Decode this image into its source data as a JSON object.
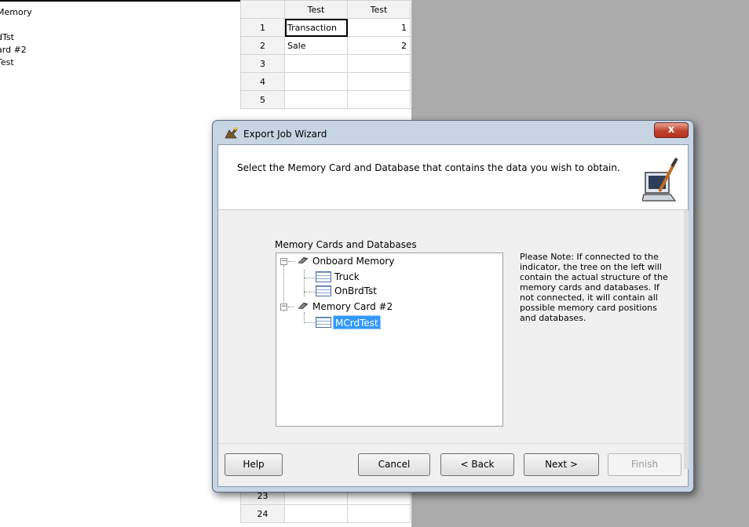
{
  "background": {
    "left_tree": [
      "Memory",
      "",
      "dTst",
      "ard #2",
      "Test"
    ],
    "grid": {
      "headers": [
        "",
        "Test",
        "Test"
      ],
      "rows": [
        {
          "num": "1",
          "c1": "Transaction",
          "c2": "1"
        },
        {
          "num": "2",
          "c1": "Sale",
          "c2": "2"
        },
        {
          "num": "3",
          "c1": "",
          "c2": ""
        },
        {
          "num": "4",
          "c1": "",
          "c2": ""
        },
        {
          "num": "5",
          "c1": "",
          "c2": ""
        }
      ],
      "bottom_rows": [
        "23",
        "24"
      ]
    }
  },
  "dialog": {
    "title": "Export Job Wizard",
    "close_label": "x",
    "instruction": "Select the Memory Card and Database that contains the data you wish to obtain.",
    "group_label": "Memory Cards and Databases",
    "tree": {
      "onboard": "Onboard Memory",
      "truck": "Truck",
      "onbrdtst": "OnBrdTst",
      "card2": "Memory Card #2",
      "mcrdtest": "MCrdTest"
    },
    "note": "Please Note: If connected to the indicator, the tree on the left will contain the actual structure of the memory cards and databases. If not connected, it will contain all possible memory card positions and databases.",
    "buttons": {
      "help": "Help",
      "cancel": "Cancel",
      "back": "< Back",
      "next": "Next >",
      "finish": "Finish"
    }
  },
  "colors": {
    "selection": "#3399ff",
    "close_button": "#c0432e",
    "dialog_frame": "#c7d4e3"
  }
}
